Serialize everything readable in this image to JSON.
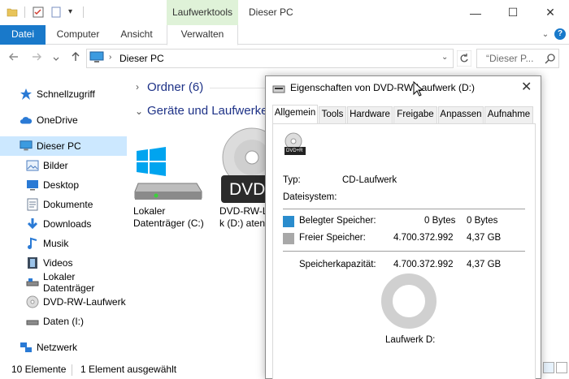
{
  "titlebar": {
    "context_label": "Laufwerktools",
    "window_title": "Dieser PC",
    "minimize_glyph": "—",
    "maximize_glyph": "☐",
    "close_glyph": "✕"
  },
  "ribbon": {
    "tabs": [
      "Datei",
      "Computer",
      "Ansicht",
      "Verwalten"
    ]
  },
  "address": {
    "path": "Dieser PC",
    "search_placeholder": "“Dieser P..."
  },
  "nav": {
    "items": [
      {
        "label": "Schnellzugriff",
        "icon": "star-icon"
      },
      {
        "label": "OneDrive",
        "icon": "cloud-icon"
      },
      {
        "label": "Dieser PC",
        "icon": "computer-icon"
      },
      {
        "label": "Bilder",
        "icon": "pictures-icon"
      },
      {
        "label": "Desktop",
        "icon": "desktop-icon"
      },
      {
        "label": "Dokumente",
        "icon": "documents-icon"
      },
      {
        "label": "Downloads",
        "icon": "downloads-icon"
      },
      {
        "label": "Musik",
        "icon": "music-icon"
      },
      {
        "label": "Videos",
        "icon": "videos-icon"
      },
      {
        "label": "Lokaler Datenträger",
        "icon": "drive-icon"
      },
      {
        "label": "DVD-RW-Laufwerk",
        "icon": "dvd-icon"
      },
      {
        "label": "Daten (I:)",
        "icon": "drive-icon"
      },
      {
        "label": "Netzwerk",
        "icon": "network-icon"
      }
    ]
  },
  "content": {
    "group_folders": "Ordner (6)",
    "group_devices": "Geräte und Laufwerke",
    "drive_c_line1": "Lokaler",
    "drive_c_line2": "Datenträger (C:)",
    "drive_d_line1": "DVD-RW-L",
    "drive_d_line2": "k (D:) aten",
    "dvd_overlay": "DVD"
  },
  "status": {
    "count": "10 Elemente",
    "selected": "1 Element ausgewählt"
  },
  "dialog": {
    "title": "Eigenschaften von DVD-RW-Laufwerk (D:)",
    "tabs": [
      "Allgemein",
      "Tools",
      "Hardware",
      "Freigabe",
      "Anpassen",
      "Aufnahme"
    ],
    "drive_badge": "DVD+R",
    "type_label": "Typ:",
    "type_value": "CD-Laufwerk",
    "fs_label": "Dateisystem:",
    "used_label": "Belegter Speicher:",
    "used_bytes": "0 Bytes",
    "used_size": "0 Bytes",
    "free_label": "Freier Speicher:",
    "free_bytes": "4.700.372.992",
    "free_size": "4,37 GB",
    "capacity_label": "Speicherkapazität:",
    "capacity_bytes": "4.700.372.992",
    "capacity_size": "4,37 GB",
    "drive_label": "Laufwerk D:",
    "used_color": "#2a8ccd",
    "free_color": "#a8a8a8"
  }
}
